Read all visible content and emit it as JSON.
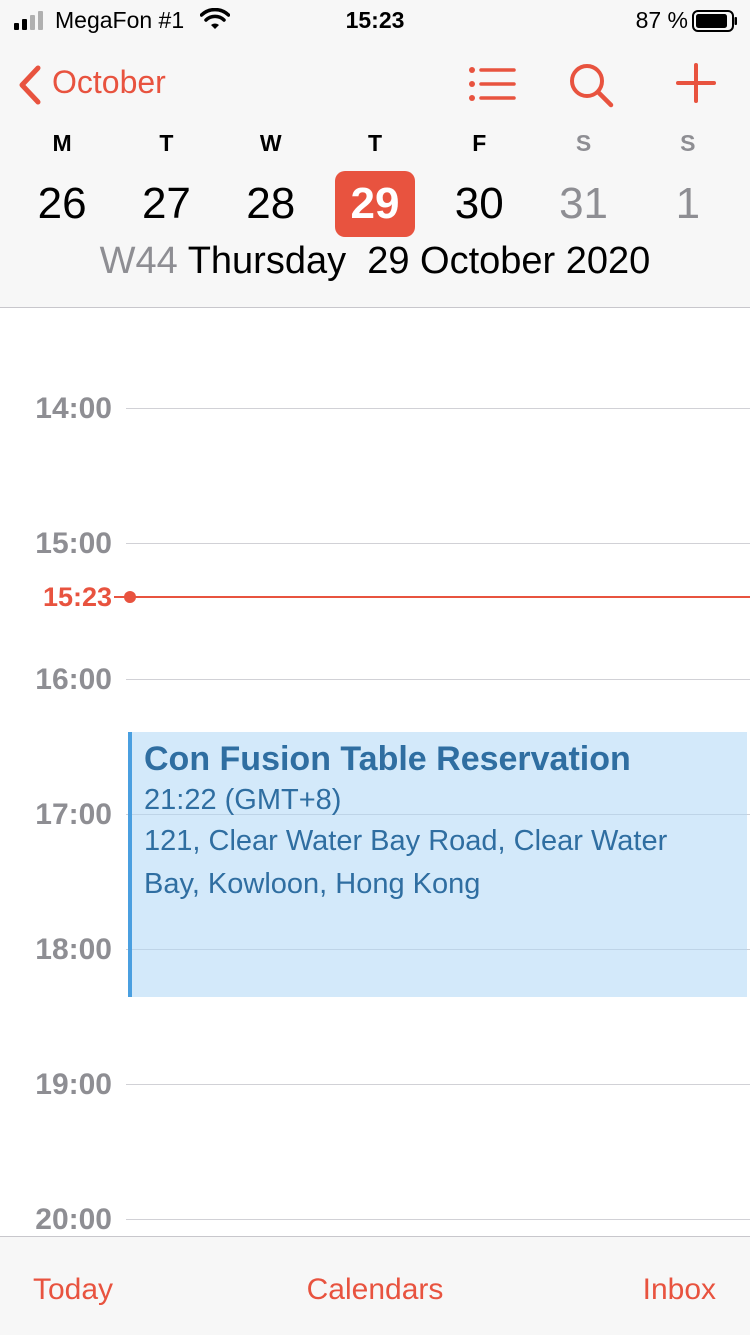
{
  "status_bar": {
    "carrier": "MegaFon #1",
    "time": "15:23",
    "battery_percent": "87 %"
  },
  "nav": {
    "back_label": "October",
    "icons": [
      "list-icon",
      "search-icon",
      "add-icon"
    ]
  },
  "week": {
    "days": [
      {
        "letter": "M",
        "date": "26"
      },
      {
        "letter": "T",
        "date": "27"
      },
      {
        "letter": "W",
        "date": "28"
      },
      {
        "letter": "T",
        "date": "29"
      },
      {
        "letter": "F",
        "date": "30"
      },
      {
        "letter": "S",
        "date": "31"
      },
      {
        "letter": "S",
        "date": "1"
      }
    ],
    "selected_date": "29",
    "week_number": "W44",
    "day_name": "Thursday",
    "full_date": "29 October 2020"
  },
  "timeline": {
    "hours": [
      "14:00",
      "15:00",
      "16:00",
      "17:00",
      "18:00",
      "19:00",
      "20:00"
    ],
    "current_time": "15:23"
  },
  "event": {
    "title": "Con Fusion Table Reservation",
    "time": "21:22 (GMT+8)",
    "location_line1": "121, Clear Water Bay Road, Clear Water",
    "location_line2": "Bay, Kowloon, Hong Kong"
  },
  "tab_bar": {
    "today": "Today",
    "calendars": "Calendars",
    "inbox": "Inbox"
  },
  "colors": {
    "accent": "#e8533f",
    "event_text": "#2f6ea1",
    "event_fill": "#d5eaf8",
    "muted": "#8e8e93"
  }
}
